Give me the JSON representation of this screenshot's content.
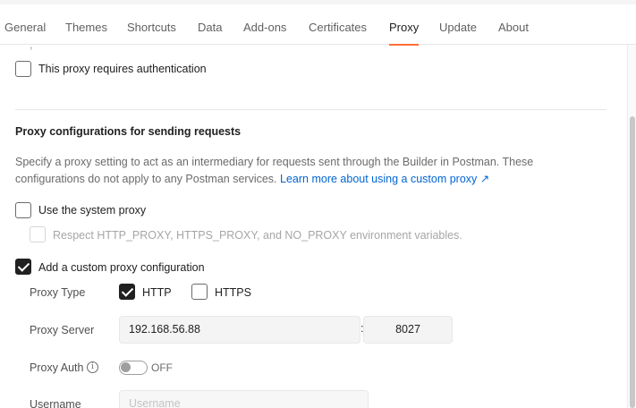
{
  "tabs": [
    {
      "label": "General"
    },
    {
      "label": "Themes"
    },
    {
      "label": "Shortcuts"
    },
    {
      "label": "Data"
    },
    {
      "label": "Add-ons"
    },
    {
      "label": "Certificates"
    },
    {
      "label": "Proxy",
      "active": true
    },
    {
      "label": "Update"
    },
    {
      "label": "About"
    }
  ],
  "auth": {
    "label": "This proxy requires authentication",
    "checked": false
  },
  "section": {
    "title": "Proxy configurations for sending requests",
    "description": "Specify a proxy setting to act as an intermediary for requests sent through the Builder in Postman. These configurations do not apply to any Postman services.",
    "link_text": "Learn more about using a custom proxy ↗"
  },
  "system_proxy": {
    "label": "Use the system proxy",
    "checked": false,
    "respect_env_label": "Respect HTTP_PROXY, HTTPS_PROXY, and NO_PROXY environment variables.",
    "respect_env_checked": false,
    "respect_env_disabled": true
  },
  "custom_proxy": {
    "label": "Add a custom proxy configuration",
    "checked": true,
    "type_label": "Proxy Type",
    "types": [
      {
        "label": "HTTP",
        "checked": true
      },
      {
        "label": "HTTPS",
        "checked": false
      }
    ],
    "server_label": "Proxy Server",
    "server_host": "192.168.56.88",
    "separator": ":",
    "server_port": "8027",
    "auth_label": "Proxy Auth",
    "auth_info_glyph": "i",
    "auth_state": "OFF",
    "auth_on": false,
    "username_label": "Username",
    "username_placeholder": "Username"
  },
  "icons": {
    "checkbox": "checkbox-icon",
    "info": "info-icon",
    "external": "external-link-icon"
  },
  "colors": {
    "accent": "#ff6c37",
    "link": "#0265d2",
    "checked": "#212121"
  }
}
